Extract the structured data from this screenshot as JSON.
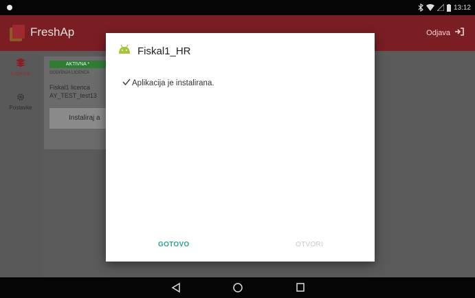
{
  "status_bar": {
    "time": "13:12"
  },
  "app": {
    "title": "FreshAp",
    "logout_label": "Odjava",
    "sidebar": [
      {
        "label": "Licence"
      },
      {
        "label": "Postavke"
      }
    ],
    "card": {
      "badge": "AKTIVNA *",
      "subtitle": "GODIŠNJA LICENCA",
      "line1": "Fiskal1 licenca",
      "line2": "AY_TEST_test13",
      "button": "Instaliraj a"
    }
  },
  "dialog": {
    "title": "Fiskal1_HR",
    "message": "Aplikacija je instalirana.",
    "done_button": "GOTOVO",
    "open_button": "OTVORI"
  },
  "colors": {
    "accent": "#26a394",
    "app_bar": "#7a1e24",
    "badge_green": "#2f7d33",
    "android_green": "#a4c639"
  }
}
